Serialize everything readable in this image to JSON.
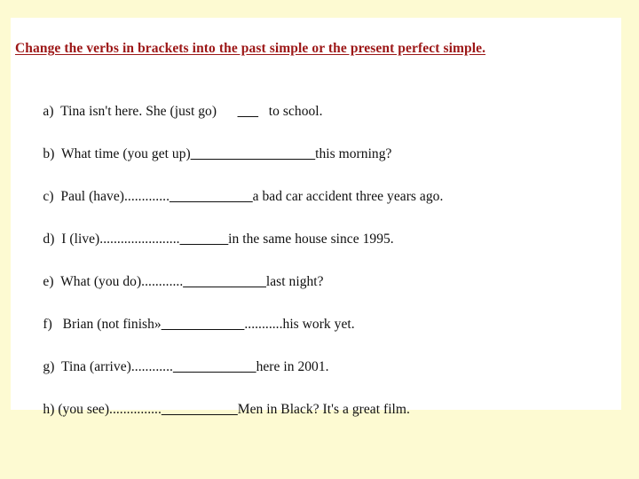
{
  "document": {
    "background_color": "#fdfad2",
    "sheet_color": "#ffffff",
    "heading": {
      "text": "Change the verbs in brackets into the past simple or the present perfect simple.",
      "color": "#9c1616"
    },
    "exercises": [
      {
        "marker": "a)",
        "prefix": "  Tina isn't here. She (just go)      ",
        "blank": "___",
        "suffix": "   to school."
      },
      {
        "marker": "b)",
        "prefix": "  What time (you get up)",
        "blank": "__________________",
        "suffix": "this morning?"
      },
      {
        "marker": "c)",
        "prefix": "  Paul (have).............",
        "blank": "____________",
        "suffix": "a bad car accident three years ago."
      },
      {
        "marker": "d)",
        "prefix": "  I (live).......................",
        "blank": "_______",
        "suffix": "in the same house since 1995."
      },
      {
        "marker": "e)",
        "prefix": "  What (you do)............",
        "blank": "____________",
        "suffix": "last night?"
      },
      {
        "marker": "f)",
        "prefix": "   Brian (not finish»",
        "blank": "____________",
        "suffix": "...........his work yet."
      },
      {
        "marker": "g)",
        "prefix": "  Tina (arrive)............",
        "blank": "____________",
        "suffix": "here in 2001."
      },
      {
        "marker": "h)",
        "prefix": " (you see)...............",
        "blank": "___________",
        "suffix": "Men in Black? It's a great film."
      }
    ]
  }
}
